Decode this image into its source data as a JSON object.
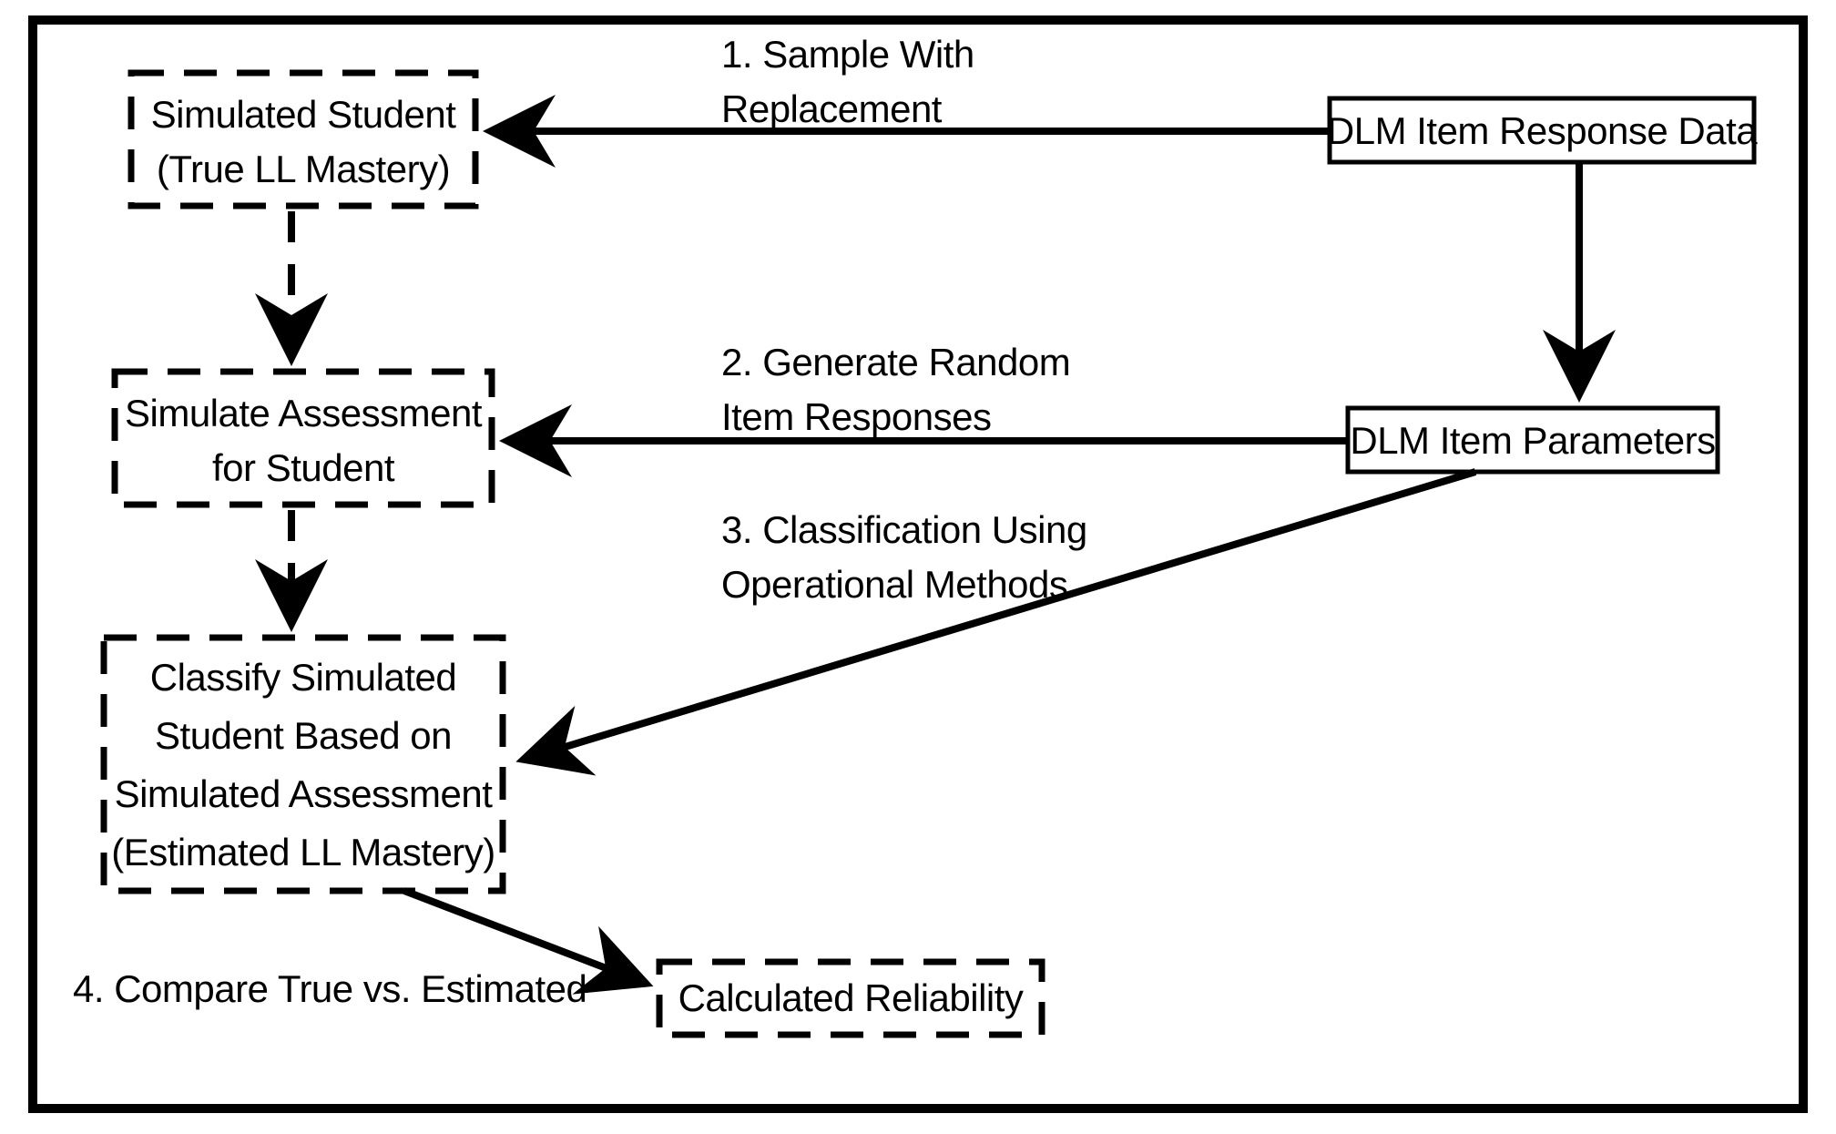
{
  "boxes": {
    "item_response_data": "DLM Item Response Data",
    "item_parameters": "DLM Item Parameters",
    "simulated_student_l1": "Simulated Student",
    "simulated_student_l2": "(True LL Mastery)",
    "simulate_assessment_l1": "Simulate Assessment",
    "simulate_assessment_l2": "for Student",
    "classify_l1": "Classify Simulated",
    "classify_l2": "Student Based on",
    "classify_l3": "Simulated Assessment",
    "classify_l4": "(Estimated LL Mastery)",
    "calc_reliability": "Calculated Reliability"
  },
  "steps": {
    "s1_l1": "1. Sample With",
    "s1_l2": "Replacement",
    "s2_l1": "2. Generate Random",
    "s2_l2": "Item Responses",
    "s3_l1": "3. Classification Using",
    "s3_l2": "Operational Methods",
    "s4": "4. Compare True vs. Estimated"
  }
}
